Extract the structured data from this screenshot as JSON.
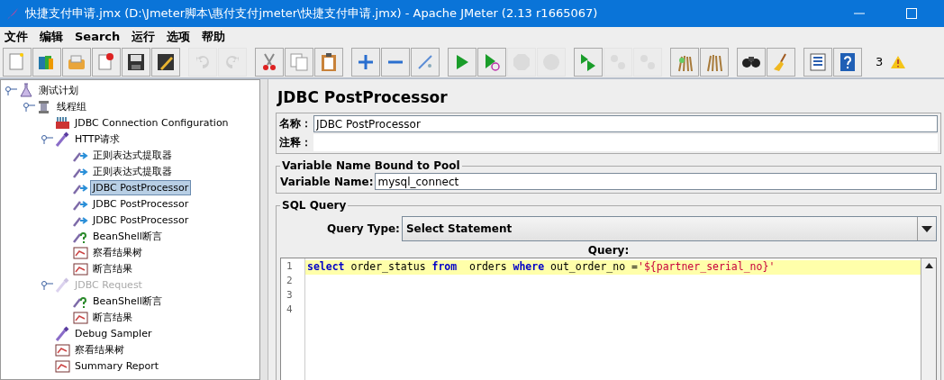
{
  "window": {
    "title": "快捷支付申请.jmx (D:\\Jmeter脚本\\惠付支付jmeter\\快捷支付申请.jmx) - Apache JMeter (2.13 r1665067)"
  },
  "menu": [
    "文件",
    "编辑",
    "Search",
    "运行",
    "选项",
    "帮助"
  ],
  "toolbar": [
    [
      {
        "kind": "new",
        "disabled": false
      },
      {
        "kind": "templates",
        "disabled": false
      },
      {
        "kind": "open",
        "disabled": false
      },
      {
        "kind": "close",
        "disabled": false
      },
      {
        "kind": "save",
        "disabled": false
      },
      {
        "kind": "saveas",
        "disabled": false
      }
    ],
    [
      {
        "kind": "undo",
        "disabled": true
      },
      {
        "kind": "redo",
        "disabled": true
      }
    ],
    [
      {
        "kind": "cut",
        "disabled": false
      },
      {
        "kind": "copy",
        "disabled": false
      },
      {
        "kind": "paste",
        "disabled": false
      }
    ],
    [
      {
        "kind": "expand",
        "disabled": false
      },
      {
        "kind": "collapse",
        "disabled": false
      },
      {
        "kind": "toggle",
        "disabled": false
      }
    ],
    [
      {
        "kind": "start",
        "disabled": false
      },
      {
        "kind": "startnopause",
        "disabled": false
      },
      {
        "kind": "stop",
        "disabled": true
      },
      {
        "kind": "shutdown",
        "disabled": true
      }
    ],
    [
      {
        "kind": "remotestart",
        "disabled": false
      },
      {
        "kind": "remotestop",
        "disabled": true
      },
      {
        "kind": "remoteexit",
        "disabled": true
      }
    ],
    [
      {
        "kind": "clear",
        "disabled": false
      },
      {
        "kind": "clearall",
        "disabled": false
      }
    ],
    [
      {
        "kind": "search",
        "disabled": false
      },
      {
        "kind": "reset",
        "disabled": false
      }
    ],
    [
      {
        "kind": "functions",
        "disabled": false
      },
      {
        "kind": "help",
        "disabled": false
      }
    ]
  ],
  "warning_count": "3",
  "tree": [
    {
      "label": "测试计划",
      "kind": "testplan",
      "selected": false,
      "disabled": false,
      "expanded": true,
      "children": [
        {
          "label": "线程组",
          "kind": "threadgroup",
          "selected": false,
          "disabled": false,
          "expanded": true,
          "children": [
            {
              "label": "JDBC Connection Configuration",
              "kind": "config",
              "selected": false,
              "disabled": false
            },
            {
              "label": "HTTP请求",
              "kind": "sampler",
              "selected": false,
              "disabled": false,
              "expanded": true,
              "children": [
                {
                  "label": "正则表达式提取器",
                  "kind": "postprocessor",
                  "selected": false,
                  "disabled": false
                },
                {
                  "label": "正则表达式提取器",
                  "kind": "postprocessor",
                  "selected": false,
                  "disabled": false
                },
                {
                  "label": "JDBC PostProcessor",
                  "kind": "postprocessor",
                  "selected": true,
                  "disabled": false
                },
                {
                  "label": "JDBC PostProcessor",
                  "kind": "postprocessor",
                  "selected": false,
                  "disabled": false
                },
                {
                  "label": "JDBC PostProcessor",
                  "kind": "postprocessor",
                  "selected": false,
                  "disabled": false
                },
                {
                  "label": "BeanShell断言",
                  "kind": "assertion",
                  "selected": false,
                  "disabled": false
                },
                {
                  "label": "察看结果树",
                  "kind": "listener",
                  "selected": false,
                  "disabled": false
                },
                {
                  "label": "断言结果",
                  "kind": "listener",
                  "selected": false,
                  "disabled": false
                }
              ]
            },
            {
              "label": "JDBC Request",
              "kind": "sampler",
              "selected": false,
              "disabled": true,
              "expanded": true,
              "children": [
                {
                  "label": "BeanShell断言",
                  "kind": "assertion",
                  "selected": false,
                  "disabled": false
                },
                {
                  "label": "断言结果",
                  "kind": "listener",
                  "selected": false,
                  "disabled": false
                }
              ]
            },
            {
              "label": "Debug Sampler",
              "kind": "sampler",
              "selected": false,
              "disabled": false
            },
            {
              "label": "察看结果树",
              "kind": "listener",
              "selected": false,
              "disabled": false
            },
            {
              "label": "Summary Report",
              "kind": "listener",
              "selected": false,
              "disabled": false
            }
          ]
        }
      ]
    }
  ],
  "panel": {
    "title": "JDBC PostProcessor",
    "name_label": "名称：",
    "name_value": "JDBC PostProcessor",
    "comment_label": "注释：",
    "pool_group": {
      "title": "Variable Name Bound to Pool",
      "label": "Variable Name:",
      "value": "mysql_connect"
    },
    "sql_group": {
      "title": "SQL Query",
      "query_type_label": "Query Type:",
      "query_type": "Select Statement",
      "query_label": "Query:",
      "lines": [
        {
          "number": "1",
          "current": true,
          "tokens": [
            {
              "kind": "keyword",
              "text": "select"
            },
            {
              "kind": "plain",
              "text": " order_status "
            },
            {
              "kind": "keyword",
              "text": "from"
            },
            {
              "kind": "plain",
              "text": "  orders "
            },
            {
              "kind": "keyword",
              "text": "where"
            },
            {
              "kind": "plain",
              "text": " out_order_no ="
            },
            {
              "kind": "string",
              "text": "'${partner_serial_no}'"
            }
          ]
        },
        {
          "number": "2",
          "current": false
        },
        {
          "number": "3",
          "current": false
        },
        {
          "number": "4",
          "current": false
        }
      ]
    }
  }
}
